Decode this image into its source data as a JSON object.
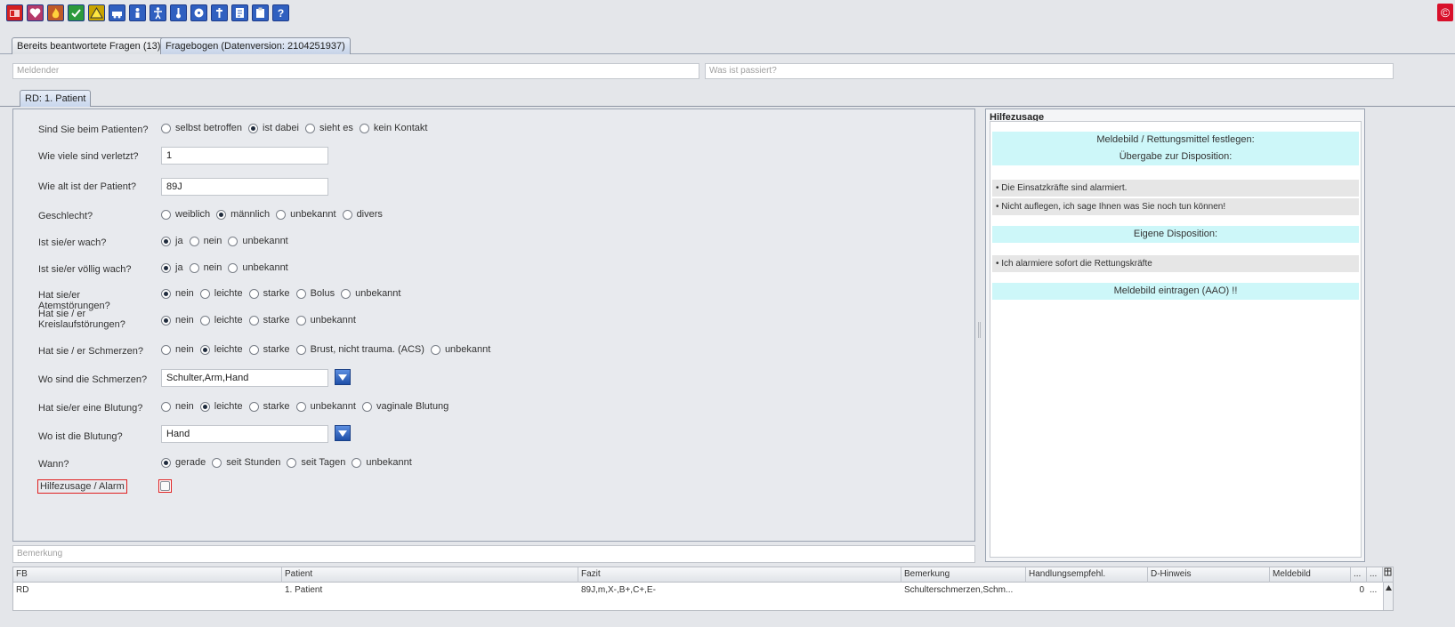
{
  "toolbar": {
    "tools": [
      {
        "icon": "category-red-icon",
        "color": "#d42020"
      },
      {
        "icon": "heart-icon",
        "color": "#b53a6a"
      },
      {
        "icon": "fire-icon",
        "color": "#c05a28"
      },
      {
        "icon": "medical-check-icon",
        "color": "#2c9a3c"
      },
      {
        "icon": "hazard-icon",
        "color": "#c9a400"
      },
      {
        "icon": "car-icon",
        "color": "#3060c0"
      },
      {
        "icon": "person-icon",
        "color": "#3060c0"
      },
      {
        "icon": "accessibility-icon",
        "color": "#3060c0"
      },
      {
        "icon": "thermometer-icon",
        "color": "#3060c0"
      },
      {
        "icon": "radiation-icon",
        "color": "#3060c0"
      },
      {
        "icon": "cross-icon",
        "color": "#3060c0"
      },
      {
        "icon": "document-icon",
        "color": "#3060c0"
      },
      {
        "icon": "clipboard-icon",
        "color": "#3060c0"
      },
      {
        "icon": "help-icon",
        "color": "#3060c0"
      }
    ],
    "help_glyph": "?",
    "alarm_glyph": "©"
  },
  "tabs": [
    {
      "label": "Bereits beantwortete Fragen (13)"
    },
    {
      "label": "Fragebogen (Datenversion: 2104251937)"
    }
  ],
  "top_fields": {
    "meldender_placeholder": "Meldender",
    "was_placeholder": "Was ist passiert?"
  },
  "patient_tab": {
    "label": "RD: 1. Patient"
  },
  "form": {
    "q1": {
      "label": "Sind Sie beim Patienten?",
      "options": [
        "selbst betroffen",
        "ist dabei",
        "sieht es",
        "kein Kontakt"
      ],
      "selected": 1
    },
    "q2": {
      "label": "Wie viele sind verletzt?",
      "value": "1"
    },
    "q3": {
      "label": "Wie alt ist der Patient?",
      "value": "89J"
    },
    "q4": {
      "label": "Geschlecht?",
      "options": [
        "weiblich",
        "männlich",
        "unbekannt",
        "divers"
      ],
      "selected": 1
    },
    "q5": {
      "label": "Ist sie/er wach?",
      "options": [
        "ja",
        "nein",
        "unbekannt"
      ],
      "selected": 0
    },
    "q6": {
      "label": "Ist sie/er völlig wach?",
      "options": [
        "ja",
        "nein",
        "unbekannt"
      ],
      "selected": 0
    },
    "q7": {
      "label": "Hat sie/er Atemstörungen?",
      "options": [
        "nein",
        "leichte",
        "starke",
        "Bolus",
        "unbekannt"
      ],
      "selected": 0
    },
    "q8": {
      "label": "Hat sie / er Kreislaufstörungen?",
      "options": [
        "nein",
        "leichte",
        "starke",
        "unbekannt"
      ],
      "selected": 0
    },
    "q9": {
      "label": "Hat sie / er Schmerzen?",
      "options": [
        "nein",
        "leichte",
        "starke",
        "Brust, nicht trauma. (ACS)",
        "unbekannt"
      ],
      "selected": 1
    },
    "q10": {
      "label": "Wo sind die Schmerzen?",
      "value": "Schulter,Arm,Hand"
    },
    "q11": {
      "label": "Hat sie/er eine Blutung?",
      "options": [
        "nein",
        "leichte",
        "starke",
        "unbekannt",
        "vaginale Blutung"
      ],
      "selected": 1
    },
    "q12": {
      "label": "Wo ist die Blutung?",
      "value": "Hand"
    },
    "q13": {
      "label": "Wann?",
      "options": [
        "gerade",
        "seit Stunden",
        "seit Tagen",
        "unbekannt"
      ],
      "selected": 0
    },
    "hilfezusage": {
      "label": "Hilfezusage / Alarm",
      "checked": false
    }
  },
  "hilfe": {
    "title": "Hilfezusage",
    "line1": "Meldebild / Rettungsmittel festlegen:",
    "line2": "Übergabe zur Disposition:",
    "bullet1": "• Die Einsatzkräfte sind alarmiert.",
    "bullet2": "• Nicht auflegen, ich sage Ihnen was Sie noch tun können!",
    "line3": "Eigene Disposition:",
    "bullet3": "• Ich alarmiere sofort die Rettungskräfte",
    "line4": "Meldebild eintragen (AAO) !!",
    "cyan_color": "#cdf7f9"
  },
  "bemerkung_placeholder": "Bemerkung",
  "table": {
    "headers": [
      "FB",
      "Patient",
      "Fazit",
      "Bemerkung",
      "Handlungsempfehl.",
      "D-Hinweis",
      "Meldebild",
      "...",
      "..."
    ],
    "rows": [
      {
        "fb": "RD",
        "patient": "1. Patient",
        "fazit": "89J,m,X-,B+,C+,E-",
        "bemerkung": "Schulterschmerzen,Schm...",
        "handlung": "",
        "dhinweis": "",
        "meldebild": "",
        "col8": "0",
        "col9": "..."
      }
    ]
  }
}
